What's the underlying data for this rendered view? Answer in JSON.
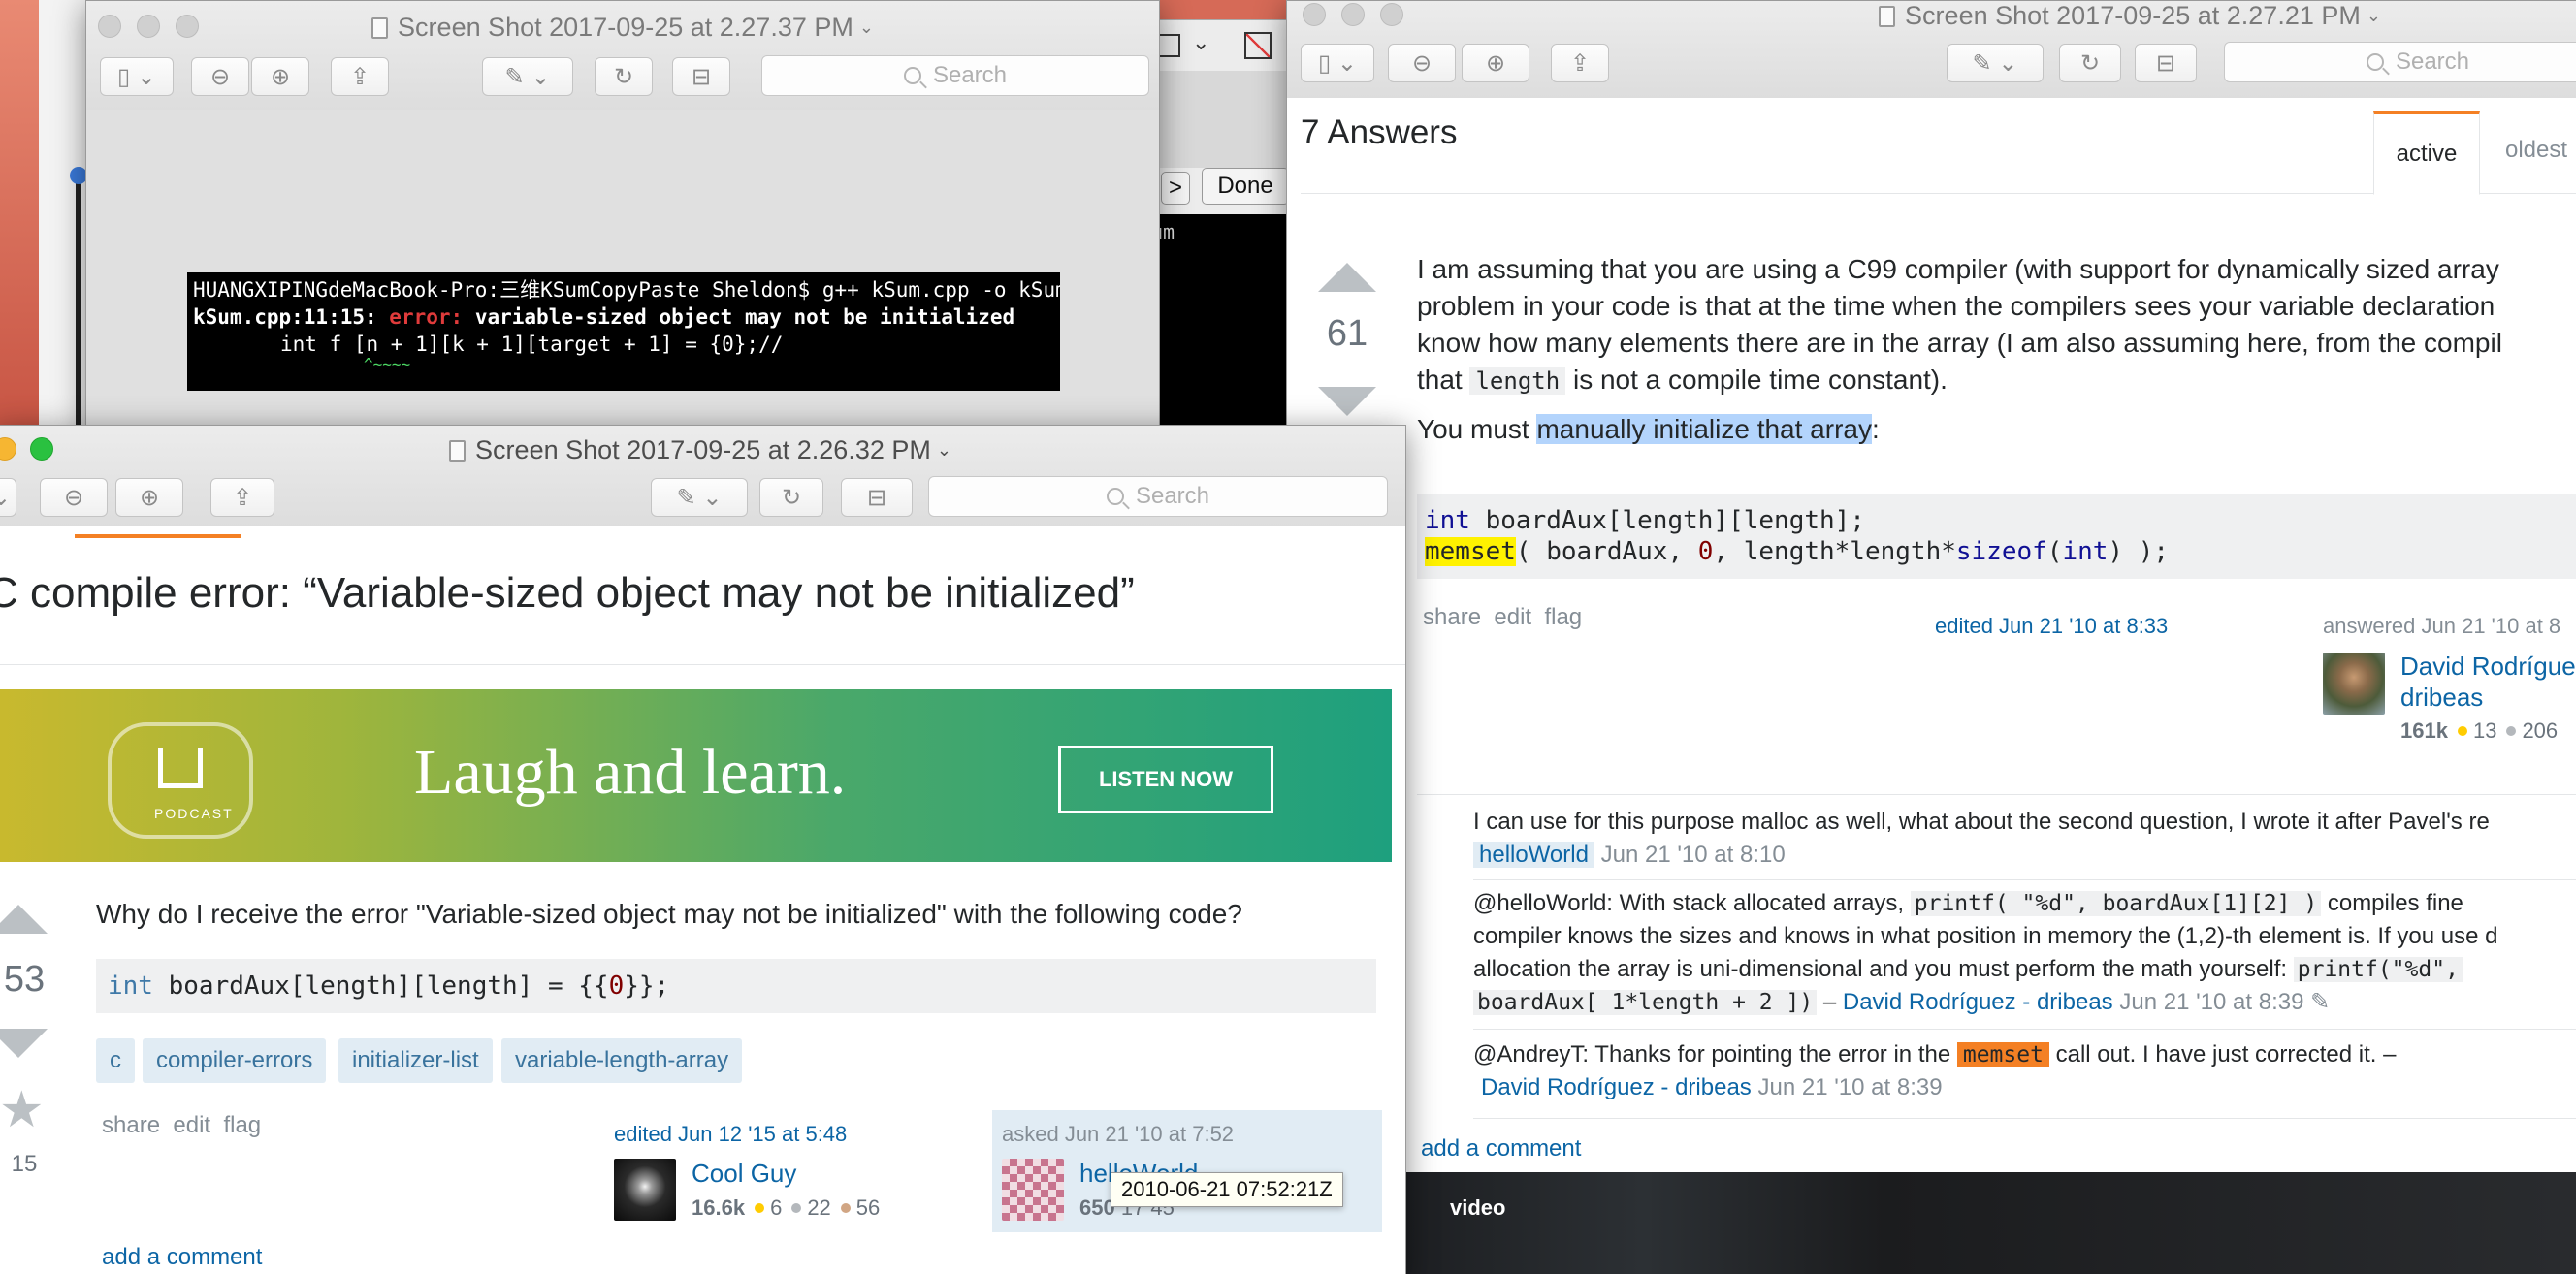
{
  "windows": {
    "top_left": {
      "title": "Screen Shot 2017-09-25 at 2.27.37 PM",
      "search_placeholder": "Search",
      "terminal": {
        "line1": "HUANGXIPINGdeMacBook-Pro:三维KSumCopyPaste Sheldon$ g++ kSum.cpp -o kSum",
        "line2_file": "kSum.cpp:11:15: ",
        "line2_error": "error: ",
        "line2_msg": "variable-sized object may not be initialized",
        "line3": "int f [n + 1][k + 1][target + 1] = {0};//",
        "line4": "^~~~~"
      }
    },
    "behind": {
      "done_label": "Done",
      "arrow_label": ">",
      "terminal_snippet": "um"
    },
    "right": {
      "title": "Screen Shot 2017-09-25 at 2.27.21 PM",
      "search_placeholder": "Search",
      "answers_header": "7 Answers",
      "tabs": [
        "active",
        "oldest"
      ],
      "vote_count": "61",
      "answer_paragraph_lines": [
        "I am assuming that you are using a C99 compiler (with support for dynamically sized array",
        "problem in your code is that at the time when the compilers sees your variable declaration",
        "know how many elements there are in the array (I am also assuming here, from the compil"
      ],
      "answer_line4_pre": "that ",
      "answer_line4_code": "length",
      "answer_line4_post": " is not a compile time constant).",
      "must_pre": "You must ",
      "must_highlight": "manually initialize that array",
      "must_post": ":",
      "code": {
        "l1_kw": "int",
        "l1_rest": " boardAux[length][length];",
        "l2_fn": "memset",
        "l2_a": "( boardAux, ",
        "l2_zero": "0",
        "l2_b": ", length*length*",
        "l2_sizeof": "sizeof",
        "l2_c": "(",
        "l2_int": "int",
        "l2_d": ") );"
      },
      "post_menu": {
        "share": "share",
        "edit": "edit",
        "flag": "flag"
      },
      "edited": "edited Jun 21 '10 at 8:33",
      "answered": "answered Jun 21 '10 at 8",
      "author_line1": "David Rodrígue",
      "author_line2": "dribeas",
      "rep": "161k",
      "gold": "13",
      "silver": "206",
      "comments": [
        {
          "text_lines": [
            "I can use for this purpose malloc as well, what about the second question, I wrote it after Pavel's re"
          ],
          "user": "helloWorld",
          "date": "Jun 21 '10 at 8:10"
        },
        {
          "line1_pre": "@helloWorld: With stack allocated arrays, ",
          "line1_code": "printf( \"%d\", boardAux[1][2] )",
          "line1_post": " compiles fine",
          "line2": "compiler knows the sizes and knows in what position in memory the (1,2)-th element is. If you use d",
          "line3_pre": "allocation the array is uni-dimensional and you must perform the math yourself: ",
          "line3_code": "printf(\"%d\",",
          "line4_code": "boardAux[ 1*length + 2 ])",
          "line4_sep": " – ",
          "user": "David Rodríguez - dribeas",
          "date": "Jun 21 '10 at 8:39"
        },
        {
          "line1_pre": "@AndreyT: Thanks for pointing the error in the ",
          "line1_code": "memset",
          "line1_post": " call out. I have just corrected it. –",
          "user": "David Rodríguez - dribeas",
          "date": "Jun 21 '10 at 8:39"
        }
      ],
      "add_comment": "add a comment",
      "video_label": "video"
    },
    "front": {
      "title": "Screen Shot 2017-09-25 at 2.26.32 PM",
      "search_placeholder": "Search",
      "question_title": "C compile error: “Variable-sized object may not be initialized”",
      "banner": {
        "podcast": "PODCAST",
        "headline": "Laugh and learn.",
        "cta": "LISTEN NOW"
      },
      "vote_count": "53",
      "fav_count": "15",
      "question_text": "Why do I receive the error \"Variable-sized object may not be initialized\" with the following code?",
      "code": {
        "kw": "int",
        "rest": " boardAux[length][length] = {{",
        "zero": "0",
        "end": "}};"
      },
      "tags": [
        "c",
        "compiler-errors",
        "initializer-list",
        "variable-length-array"
      ],
      "post_menu": {
        "share": "share",
        "edit": "edit",
        "flag": "flag"
      },
      "edited": "edited Jun 12 '15 at 5:48",
      "editor": "Cool Guy",
      "editor_rep": "16.6k",
      "editor_gold": "6",
      "editor_silver": "22",
      "editor_bronze": "56",
      "asked": "asked Jun 21 '10 at 7:52",
      "asker": "helloWorld",
      "asker_rep": "650",
      "asker_partial": "17  45",
      "tooltip": "2010-06-21 07:52:21Z",
      "add_comment": "add a comment"
    }
  },
  "colors": {
    "desktop": "#d66a57",
    "banner_start": "#c9b92e",
    "banner_end": "#1ea07e",
    "link": "#0c65a5",
    "tag_bg": "#e1ecf4",
    "tag_fg": "#39739d",
    "highlight": "#b3d4fc",
    "memset_hl": "#fff200",
    "error": "#e03b3b"
  }
}
